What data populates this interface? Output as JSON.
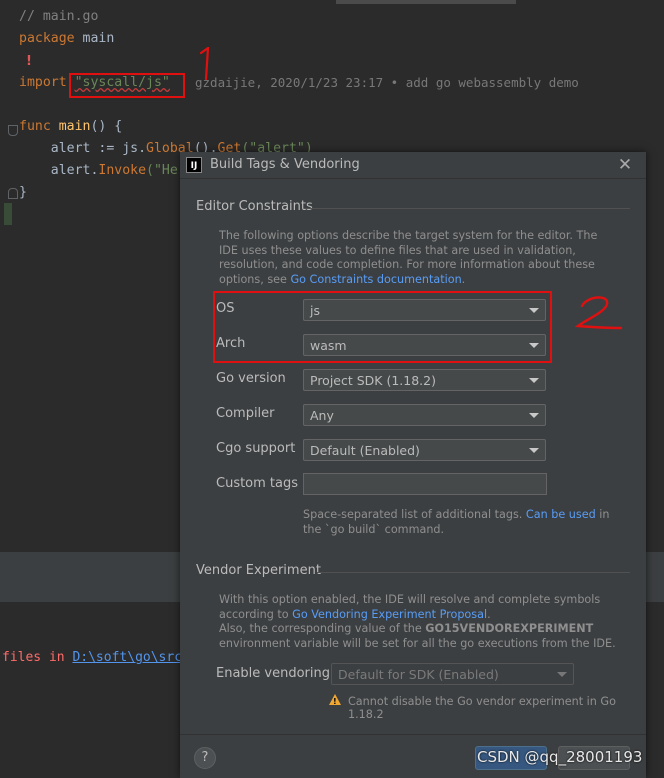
{
  "editor": {
    "line_comment": "// main.go",
    "line_package_kw": "package",
    "line_package_name": " main",
    "line_import_kw": "import",
    "line_import_path": "\"syscall/js\"",
    "blame": "gzdaijie, 2020/1/23 23:17 • add go webassembly demo",
    "line_func_kw": "func",
    "line_func_name": "main",
    "line_func_rest": "() {",
    "line_alert1_a": "    alert := js.",
    "line_alert1_b": "Global",
    "line_alert1_c": "().",
    "line_alert1_d": "Get",
    "line_alert1_e": "(\"alert\")",
    "line_alert2_a": "    alert.",
    "line_alert2_b": "Invoke",
    "line_alert2_c": "(\"He",
    "line_close": "}",
    "annotation_1": "1"
  },
  "bottom": {
    "files_prefix": "files in ",
    "files_path": "D:\\soft\\go\\src"
  },
  "dialog": {
    "title": "Build Tags & Vendoring",
    "logo": "IJ",
    "section1_title": "Editor Constraints",
    "section1_desc_1": "The following options describe the target system for the editor. The IDE uses these values to define files that are used in validation, resolution, and code completion. For more information about these options, see ",
    "section1_desc_link": "Go Constraints documentation",
    "section1_desc_2": ".",
    "os_label": "OS",
    "os_value": "js",
    "arch_label": "Arch",
    "arch_value": "wasm",
    "go_version_label": "Go version",
    "go_version_value": "Project SDK (1.18.2)",
    "compiler_label": "Compiler",
    "compiler_value": "Any",
    "cgo_label": "Cgo support",
    "cgo_value": "Default (Enabled)",
    "custom_tags_label": "Custom tags",
    "custom_tags_value": "",
    "custom_tags_hint_1": "Space-separated list of additional tags. ",
    "custom_tags_hint_link": "Can be used",
    "custom_tags_hint_2": " in the `go build` command.",
    "section2_title": "Vendor Experiment",
    "section2_desc_1": "With this option enabled, the IDE will resolve and complete symbols according to ",
    "section2_desc_link": "Go Vendoring Experiment Proposal",
    "section2_desc_2": ".",
    "section2_desc_3": "Also, the corresponding value of the ",
    "section2_desc_bold": "GO15VENDOREXPERIMENT",
    "section2_desc_4": " environment variable will be set for all the go executions from the IDE.",
    "vendoring_label": "Enable vendoring",
    "vendoring_value": "Default for SDK (Enabled)",
    "warning": "Cannot disable the Go vendor experiment in Go 1.18.2",
    "help": "?",
    "annotation_2": "2"
  },
  "watermark": "CSDN @qq_28001193",
  "colors": {
    "annotation_red": "#e01010",
    "link": "#589df6",
    "warning": "#f0a732"
  }
}
